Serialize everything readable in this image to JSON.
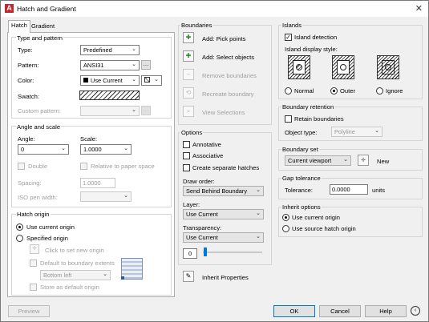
{
  "window": {
    "title": "Hatch and Gradient"
  },
  "tabs": [
    {
      "label": "Hatch"
    },
    {
      "label": "Gradient"
    }
  ],
  "type_pattern": {
    "group_label": "Type and pattern",
    "type_label": "Type:",
    "type_value": "Predefined",
    "pattern_label": "Pattern:",
    "pattern_value": "ANSI31",
    "color_label": "Color:",
    "color_value": "Use Current",
    "swatch_label": "Swatch:",
    "custom_label": "Custom pattern:"
  },
  "angle_scale": {
    "group_label": "Angle and scale",
    "angle_label": "Angle:",
    "angle_value": "0",
    "scale_label": "Scale:",
    "scale_value": "1.0000",
    "double_label": "Double",
    "relative_label": "Relative to paper space",
    "spacing_label": "Spacing:",
    "spacing_value": "1.0000",
    "iso_label": "ISO pen width:"
  },
  "hatch_origin": {
    "group_label": "Hatch origin",
    "use_current": "Use current origin",
    "specified": "Specified origin",
    "click_set": "Click to set new origin",
    "default_extents": "Default to boundary extents",
    "extents_value": "Bottom left",
    "store_default": "Store as default origin"
  },
  "boundaries": {
    "group_label": "Boundaries",
    "add_pick": "Add: Pick points",
    "add_select": "Add: Select objects",
    "remove": "Remove boundaries",
    "recreate": "Recreate boundary",
    "view": "View Selections"
  },
  "options": {
    "group_label": "Options",
    "annotative": "Annotative",
    "associative": "Associative",
    "separate": "Create separate hatches",
    "draw_order_label": "Draw order:",
    "draw_order_value": "Send Behind Boundary",
    "layer_label": "Layer:",
    "layer_value": "Use Current",
    "transparency_label": "Transparency:",
    "transparency_value": "Use Current",
    "transparency_number": "0"
  },
  "inherit_properties": "Inherit Properties",
  "islands": {
    "group_label": "Islands",
    "detection": "Island detection",
    "style_label": "Island display style:",
    "normal": "Normal",
    "outer": "Outer",
    "ignore": "Ignore"
  },
  "boundary_retention": {
    "group_label": "Boundary retention",
    "retain": "Retain boundaries",
    "object_type_label": "Object type:",
    "object_type_value": "Polyline"
  },
  "boundary_set": {
    "group_label": "Boundary set",
    "value": "Current viewport",
    "new": "New"
  },
  "gap_tolerance": {
    "group_label": "Gap tolerance",
    "tolerance_label": "Tolerance:",
    "tolerance_value": "0.0000",
    "units": "units"
  },
  "inherit_options": {
    "group_label": "Inherit options",
    "use_current": "Use current origin",
    "use_source": "Use source hatch origin"
  },
  "footer": {
    "preview": "Preview",
    "ok": "OK",
    "cancel": "Cancel",
    "help": "Help"
  }
}
